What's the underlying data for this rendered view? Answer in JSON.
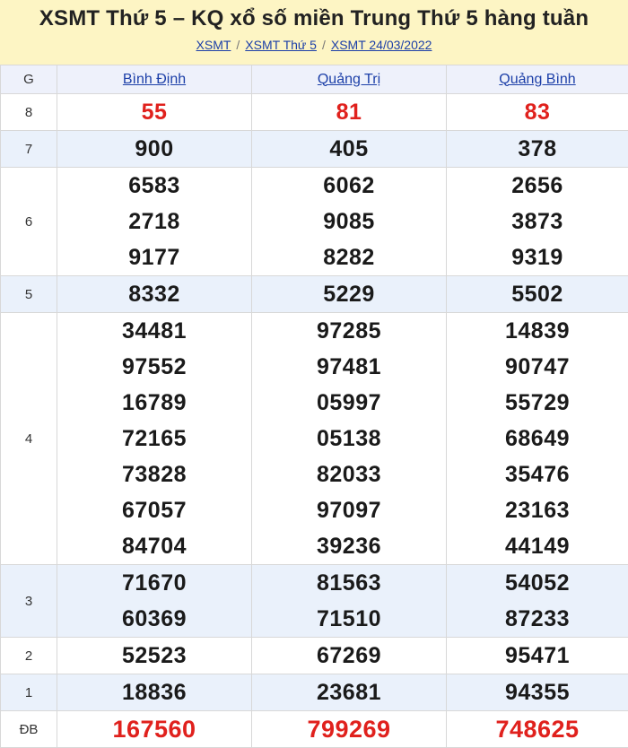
{
  "header": {
    "title": "XSMT Thứ 5 – KQ xổ số miền Trung Thứ 5 hàng tuần",
    "breadcrumb": [
      "XSMT",
      "XSMT Thứ 5",
      "XSMT 24/03/2022"
    ],
    "separator": "/"
  },
  "table": {
    "corner_label": "G",
    "provinces": [
      "Bình Định",
      "Quảng Trị",
      "Quảng Bình"
    ],
    "prizes": [
      {
        "label": "8",
        "results": [
          [
            "55"
          ],
          [
            "81"
          ],
          [
            "83"
          ]
        ]
      },
      {
        "label": "7",
        "results": [
          [
            "900"
          ],
          [
            "405"
          ],
          [
            "378"
          ]
        ]
      },
      {
        "label": "6",
        "results": [
          [
            "6583",
            "2718",
            "9177"
          ],
          [
            "6062",
            "9085",
            "8282"
          ],
          [
            "2656",
            "3873",
            "9319"
          ]
        ]
      },
      {
        "label": "5",
        "results": [
          [
            "8332"
          ],
          [
            "5229"
          ],
          [
            "5502"
          ]
        ]
      },
      {
        "label": "4",
        "results": [
          [
            "34481",
            "97552",
            "16789",
            "72165",
            "73828",
            "67057",
            "84704"
          ],
          [
            "97285",
            "97481",
            "05997",
            "05138",
            "82033",
            "97097",
            "39236"
          ],
          [
            "14839",
            "90747",
            "55729",
            "68649",
            "35476",
            "23163",
            "44149"
          ]
        ]
      },
      {
        "label": "3",
        "results": [
          [
            "71670",
            "60369"
          ],
          [
            "81563",
            "71510"
          ],
          [
            "54052",
            "87233"
          ]
        ]
      },
      {
        "label": "2",
        "results": [
          [
            "52523"
          ],
          [
            "67269"
          ],
          [
            "95471"
          ]
        ]
      },
      {
        "label": "1",
        "results": [
          [
            "18836"
          ],
          [
            "23681"
          ],
          [
            "94355"
          ]
        ]
      },
      {
        "label": "ĐB",
        "results": [
          [
            "167560"
          ],
          [
            "799269"
          ],
          [
            "748625"
          ]
        ]
      }
    ]
  },
  "colors": {
    "header_bg": "#fdf5c4",
    "link": "#1c3fa8",
    "highlight": "#e0211d",
    "alt_row": "#eaf1fb"
  }
}
